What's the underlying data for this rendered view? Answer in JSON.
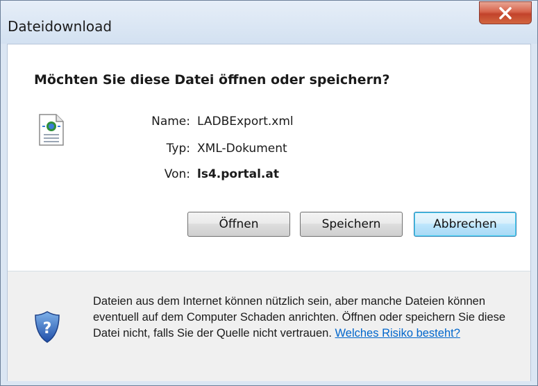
{
  "window": {
    "title": "Dateidownload",
    "close_icon": "close-icon"
  },
  "dialog": {
    "question": "Möchten Sie diese Datei öffnen oder speichern?",
    "file_icon": "xml-document-icon",
    "fields": {
      "name_label": "Name:",
      "name_value": "LADBExport.xml",
      "type_label": "Typ:",
      "type_value": "XML-Dokument",
      "from_label": "Von:",
      "from_value": "ls4.portal.at"
    },
    "buttons": {
      "open": "Öffnen",
      "save": "Speichern",
      "cancel": "Abbrechen"
    }
  },
  "footer": {
    "shield_icon": "security-shield-icon",
    "warning_text": "Dateien aus dem Internet können nützlich sein, aber manche Dateien können eventuell auf dem Computer Schaden anrichten. Öffnen oder speichern Sie diese Datei nicht, falls Sie der Quelle nicht vertrauen.",
    "risk_link": "Welches Risiko besteht?"
  },
  "colors": {
    "link": "#0066cc",
    "close_button": "#c7432b",
    "default_button_border": "#3c7fb1"
  }
}
